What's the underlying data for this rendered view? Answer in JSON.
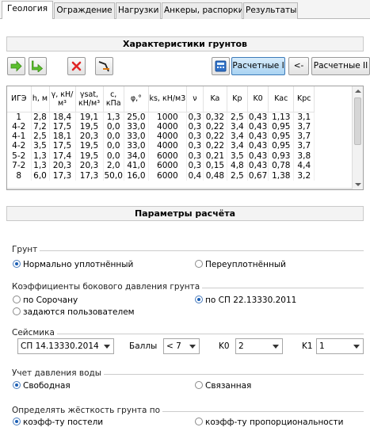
{
  "tabs": [
    {
      "label": "Геология",
      "active": true
    },
    {
      "label": "Ограждение",
      "active": false
    },
    {
      "label": "Нагрузки",
      "active": false
    },
    {
      "label": "Анкеры, распорки",
      "active": false
    },
    {
      "label": "Результаты",
      "active": false
    }
  ],
  "soil_section": {
    "title": "Характеристики грунтов",
    "toolbar": {
      "icons": [
        "add-row-icon",
        "insert-row-icon",
        "delete-row-icon",
        "chart-icon",
        "calculator-icon"
      ],
      "calc1_label": "Расчетные I",
      "swap_label": "<-",
      "calc2_label": "Расчетные II"
    },
    "columns": [
      "ИГЭ",
      "h, м",
      "γ, кН/м³",
      "γsat, кН/м³",
      "c, кПа",
      "φ,°",
      "ks, кН/м3",
      "ν",
      "Ka",
      "Kp",
      "K0",
      "Kac",
      "Kpc"
    ],
    "rows": [
      [
        "1",
        "2,8",
        "18,4",
        "19,1",
        "1,3",
        "25,0",
        "1000",
        "0,3",
        "0,32",
        "2,5",
        "0,43",
        "1,13",
        "3,1"
      ],
      [
        "4-2",
        "7,2",
        "17,5",
        "19,5",
        "0,0",
        "33,0",
        "4000",
        "0,3",
        "0,22",
        "3,4",
        "0,43",
        "0,95",
        "3,7"
      ],
      [
        "4-1",
        "2,5",
        "18,1",
        "20,3",
        "0,0",
        "33,0",
        "4000",
        "0,3",
        "0,22",
        "3,4",
        "0,43",
        "0,95",
        "3,7"
      ],
      [
        "4-2",
        "3,5",
        "17,5",
        "19,5",
        "0,0",
        "33,0",
        "4000",
        "0,3",
        "0,22",
        "3,4",
        "0,43",
        "0,95",
        "3,7"
      ],
      [
        "5-2",
        "1,3",
        "17,4",
        "19,5",
        "0,0",
        "34,0",
        "6000",
        "0,3",
        "0,21",
        "3,5",
        "0,43",
        "0,93",
        "3,8"
      ],
      [
        "7-2",
        "1,3",
        "20,3",
        "20,3",
        "2,0",
        "41,0",
        "6000",
        "0,3",
        "0,15",
        "4,8",
        "0,43",
        "0,78",
        "4,4"
      ],
      [
        "8",
        "6,0",
        "17,3",
        "17,3",
        "50,0",
        "16,0",
        "6000",
        "0,4",
        "0,48",
        "2,5",
        "0,67",
        "1,38",
        "3,2"
      ]
    ]
  },
  "params": {
    "title": "Параметры расчёта",
    "soil": {
      "label": "Грунт",
      "opt1": "Нормально уплотнённый",
      "opt2": "Переуплотнённый"
    },
    "coef": {
      "label": "Коэффициенты бокового давления грунта",
      "opt1": "по Сорочану",
      "opt2": "по СП 22.13330.2011",
      "opt3": "задаются пользователем"
    },
    "seismic": {
      "label": "Сейсмика",
      "standard": "СП 14.13330.2014",
      "points_label": "Баллы",
      "points_value": "< 7",
      "k0_label": "K0",
      "k0_value": "2",
      "k1_label": "K1",
      "k1_value": "1"
    },
    "water": {
      "label": "Учет давления воды",
      "opt1": "Свободная",
      "opt2": "Связанная"
    },
    "stiffness": {
      "label": "Определять жёсткость грунта по",
      "opt1": "коэфф-ту постели",
      "opt2": "коэфф-ту пропорциональности"
    }
  }
}
